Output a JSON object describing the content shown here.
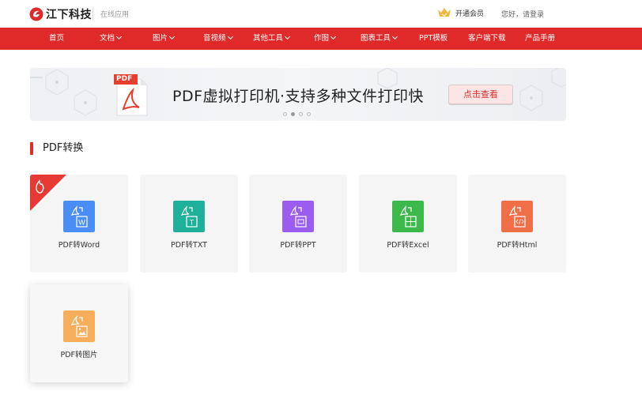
{
  "header": {
    "logo_text": "江下科技",
    "logo_sub": "在线应用",
    "vip_label": "开通会员",
    "login_label": "您好，请登录"
  },
  "nav": {
    "items": [
      {
        "label": "首页",
        "dropdown": false
      },
      {
        "label": "文档",
        "dropdown": true
      },
      {
        "label": "图片",
        "dropdown": true
      },
      {
        "label": "音视频",
        "dropdown": true
      },
      {
        "label": "其他工具",
        "dropdown": true
      },
      {
        "label": "作图",
        "dropdown": true
      },
      {
        "label": "图表工具",
        "dropdown": true
      },
      {
        "label": "PPT模板",
        "dropdown": false
      },
      {
        "label": "客户端下载",
        "dropdown": false
      },
      {
        "label": "产品手册",
        "dropdown": false
      }
    ]
  },
  "banner": {
    "title": "PDF虚拟打印机·支持多种文件打印快",
    "button_label": "点击查看",
    "pdf_badge": "PDF",
    "slides_count": 4,
    "active_slide": 2
  },
  "section": {
    "title": "PDF转换"
  },
  "cards": [
    {
      "label": "PDF转Word",
      "icon": "pdf-to-word-icon",
      "color": "#4a8ef5",
      "badge": "W",
      "hot": true
    },
    {
      "label": "PDF转TXT",
      "icon": "pdf-to-txt-icon",
      "color": "#1fb09a",
      "badge": "T",
      "hot": false
    },
    {
      "label": "PDF转PPT",
      "icon": "pdf-to-ppt-icon",
      "color": "#9b5cf0",
      "badge": "▭",
      "hot": false
    },
    {
      "label": "PDF转Excel",
      "icon": "pdf-to-excel-icon",
      "color": "#3cb94a",
      "badge": "▦",
      "hot": false
    },
    {
      "label": "PDF转Html",
      "icon": "pdf-to-html-icon",
      "color": "#f06f48",
      "badge": "</>",
      "hot": false
    },
    {
      "label": "PDF转图片",
      "icon": "pdf-to-image-icon",
      "color": "#f6ae5c",
      "badge": "▲",
      "hot": false
    }
  ],
  "colors": {
    "accent": "#e02a29",
    "card_bg": "#f5f5f5"
  }
}
